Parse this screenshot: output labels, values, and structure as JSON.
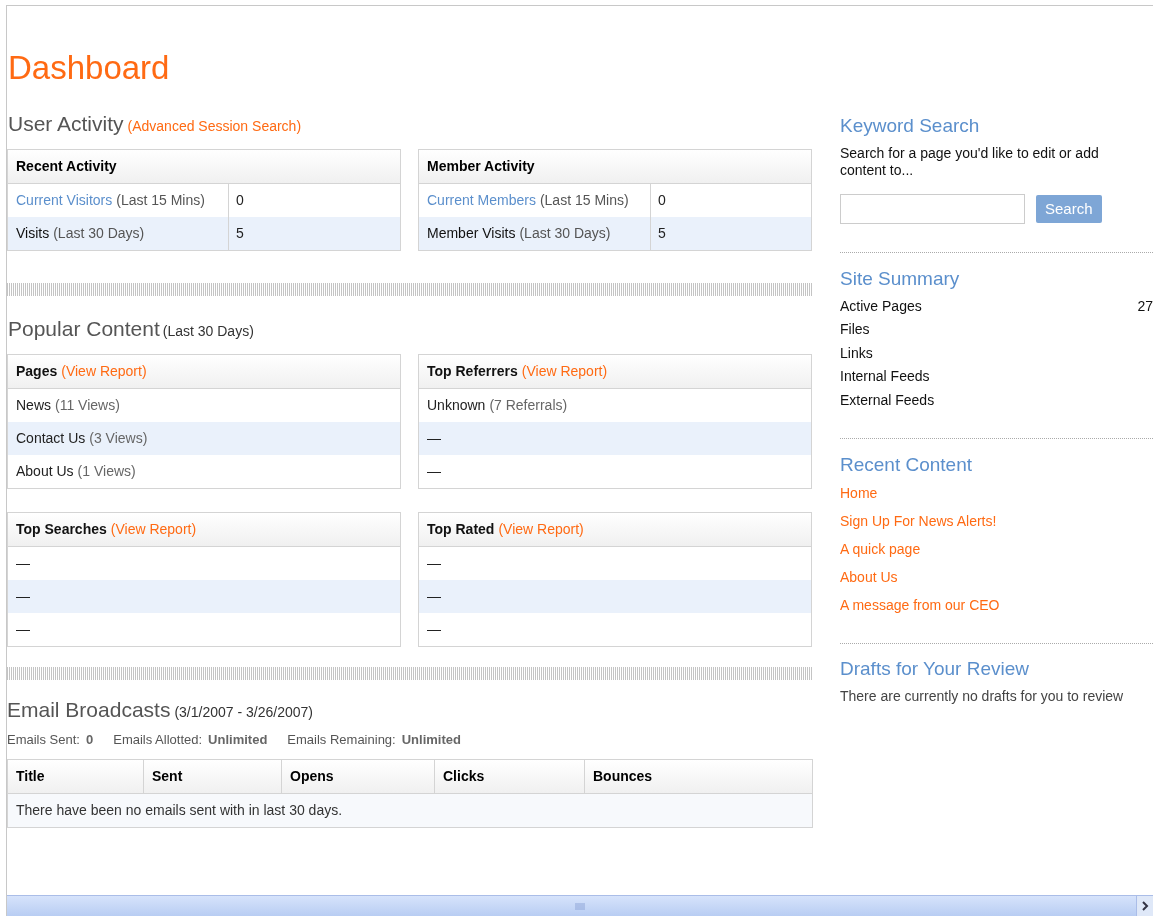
{
  "title": "Dashboard",
  "user_activity": {
    "heading": "User Activity",
    "link": "(Advanced Session Search)",
    "tables": [
      {
        "title": "Recent Activity",
        "rows": [
          {
            "kind": "link",
            "label": "Current Visitors",
            "note": "(Last 15 Mins)",
            "value": "0"
          },
          {
            "kind": "text",
            "label": "Visits",
            "note": "(Last 30 Days)",
            "value": "5"
          }
        ]
      },
      {
        "title": "Member Activity",
        "rows": [
          {
            "kind": "link",
            "label": "Current Members",
            "note": "(Last 15 Mins)",
            "value": "0"
          },
          {
            "kind": "text",
            "label": "Member Visits",
            "note": "(Last 30 Days)",
            "value": "5"
          }
        ]
      }
    ]
  },
  "popular_content": {
    "heading": "Popular Content",
    "note": "(Last 30 Days)",
    "panels": [
      {
        "title": "Pages",
        "link": "(View Report)",
        "rows": [
          {
            "label": "News",
            "note": "(11 Views)"
          },
          {
            "label": "Contact Us",
            "note": "(3 Views)"
          },
          {
            "label": "About Us",
            "note": "(1 Views)"
          }
        ]
      },
      {
        "title": "Top Referrers",
        "link": "(View Report)",
        "rows": [
          {
            "label": "Unknown",
            "note": "(7 Referrals)"
          },
          {
            "label": "—"
          },
          {
            "label": "—"
          }
        ]
      },
      {
        "title": "Top Searches",
        "link": "(View Report)",
        "rows": [
          {
            "label": "—"
          },
          {
            "label": "—"
          },
          {
            "label": "—"
          }
        ]
      },
      {
        "title": "Top Rated",
        "link": "(View Report)",
        "rows": [
          {
            "label": "—"
          },
          {
            "label": "—"
          },
          {
            "label": "—"
          }
        ]
      }
    ]
  },
  "email_broadcasts": {
    "heading": "Email Broadcasts",
    "date_range": "(3/1/2007 - 3/26/2007)",
    "stats": [
      {
        "label": "Emails Sent:",
        "value": "0"
      },
      {
        "label": "Emails Allotted:",
        "value": "Unlimited"
      },
      {
        "label": "Emails Remaining:",
        "value": "Unlimited"
      }
    ],
    "columns": [
      "Title",
      "Sent",
      "Opens",
      "Clicks",
      "Bounces"
    ],
    "empty_message": "There have been no emails sent with in last 30 days."
  },
  "sidebar": {
    "keyword_search": {
      "heading": "Keyword Search",
      "text": "Search for a page you'd like to edit or add content to...",
      "button": "Search"
    },
    "site_summary": {
      "heading": "Site Summary",
      "items": [
        {
          "label": "Active Pages",
          "value": "27"
        },
        {
          "label": "Files"
        },
        {
          "label": "Links"
        },
        {
          "label": "Internal Feeds"
        },
        {
          "label": "External Feeds"
        }
      ]
    },
    "recent_content": {
      "heading": "Recent Content",
      "links": [
        "Home",
        "Sign Up For News Alerts!",
        "A quick page",
        "About Us",
        "A message from our CEO"
      ]
    },
    "drafts": {
      "heading": "Drafts for Your Review",
      "text": "There are currently no drafts for you to review"
    }
  }
}
